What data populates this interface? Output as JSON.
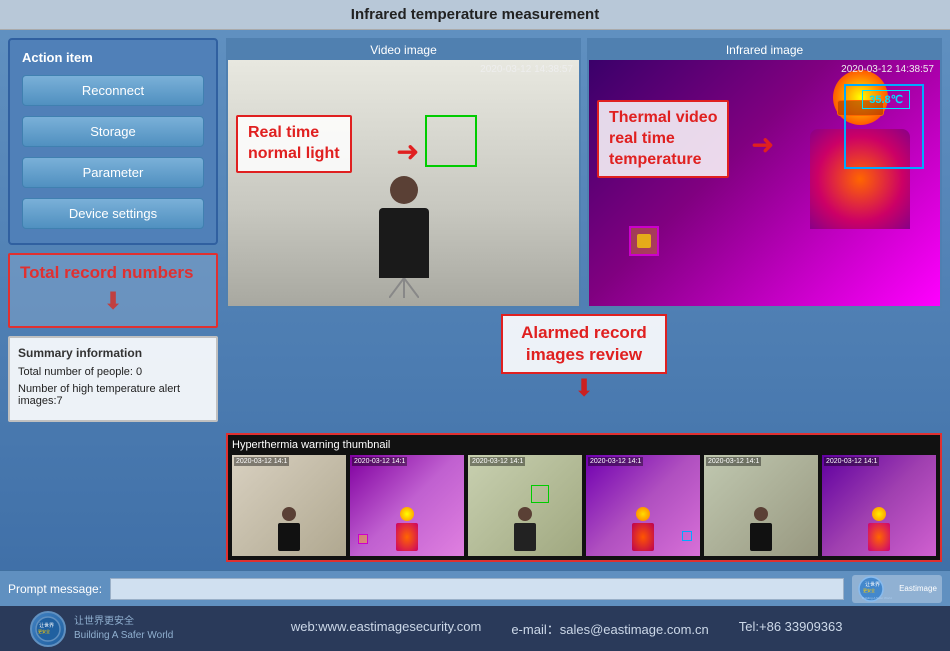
{
  "title": "Infrared temperature measurement",
  "left_panel": {
    "action_item_label": "Action item",
    "buttons": [
      "Reconnect",
      "Storage",
      "Parameter",
      "Device settings"
    ],
    "total_record_label": "Total record numbers",
    "summary": {
      "title": "Summary information",
      "people_label": "Total number of people:",
      "people_value": " 0",
      "alert_label": "Number of high temperature alert images:",
      "alert_value": "7"
    },
    "prompt_label": "Prompt message:"
  },
  "video_section": {
    "video_image_label": "Video image",
    "infrared_image_label": "Infrared image",
    "timestamp_left": "2020-03-12 14:38:57",
    "timestamp_right": "2020-03-12 14:38:57",
    "temp_value": "35.8℃",
    "annotation_normal": "Real time\nnormal light",
    "annotation_thermal": "Thermal video\nreal time\ntemperature"
  },
  "alarmed_section": {
    "label": "Alarmed record\nimages review",
    "thumbnails_header": "Hyperthermia warning thumbnail",
    "thumbnails": [
      {
        "timestamp": "2020-03-12 14:1",
        "type": "normal"
      },
      {
        "timestamp": "2020-03-12 14:1",
        "type": "thermal"
      },
      {
        "timestamp": "2020-03-12 14:1",
        "type": "normal"
      },
      {
        "timestamp": "2020-03-12 14:1",
        "type": "thermal"
      },
      {
        "timestamp": "2020-03-12 14:1",
        "type": "normal"
      },
      {
        "timestamp": "2020-03-12 14:1",
        "type": "thermal"
      }
    ]
  },
  "footer": {
    "website": "web:www.eastimagesecurity.com",
    "email": "e-mail：sales@eastimage.com.cn",
    "tel": "Tel:+86 33909363",
    "brand_line1": "让世界更安全",
    "brand_line2": "Building A Safer World"
  }
}
